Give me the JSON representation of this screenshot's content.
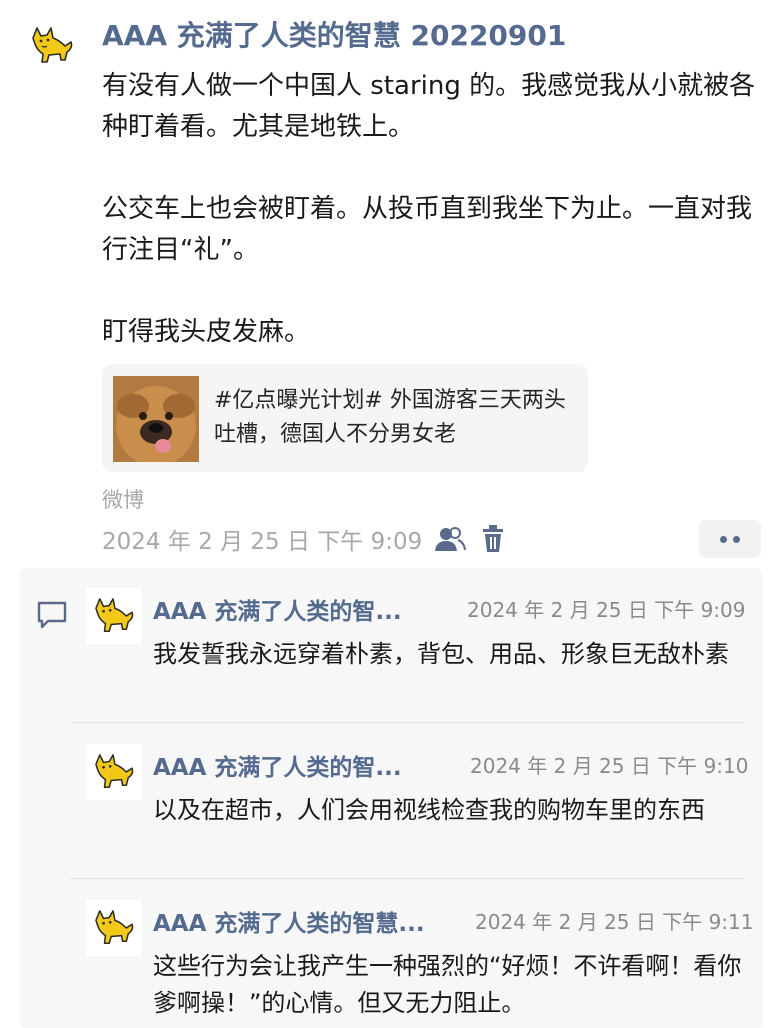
{
  "post": {
    "author": "AAA 充满了人类的智慧 20220901",
    "paragraphs": [
      "有没有人做一个中国人 staring 的。我感觉我从小就被各种盯着看。尤其是地铁上。",
      "公交车上也会被盯着。从投币直到我坐下为止。一直对我行注目“礼”。",
      "盯得我头皮发麻。"
    ],
    "link_card": {
      "text": "#亿点曝光计划# 外国游客三天两头吐槽，德国人不分男女老"
    },
    "source": "微博",
    "timestamp": "2024 年 2 月 25 日  下午 9:09"
  },
  "comments": [
    {
      "author": "AAA 充满了人类的智...",
      "time": "2024 年 2 月 25 日  下午 9:09",
      "text": "我发誓我永远穿着朴素，背包、用品、形象巨无敌朴素"
    },
    {
      "author": "AAA 充满了人类的智...",
      "time": "2024 年 2 月 25 日  下午 9:10",
      "text": "以及在超市，人们会用视线检查我的购物车里的东西"
    },
    {
      "author": "AAA 充满了人类的智慧...",
      "time": "2024 年 2 月 25 日  下午 9:11",
      "text": "这些行为会让我产生一种强烈的“好烦！不许看啊！看你爹啊操！”的心情。但又无力阻止。"
    }
  ],
  "colors": {
    "name": "#556a8f",
    "meta": "#a8a8a8",
    "comment_bg": "#f7f7f7",
    "icon": "#5a6a8c"
  },
  "icons": {
    "visibility": "people-icon",
    "delete": "trash-icon",
    "more": "more-dots-icon",
    "comment": "comment-bubble-icon"
  }
}
